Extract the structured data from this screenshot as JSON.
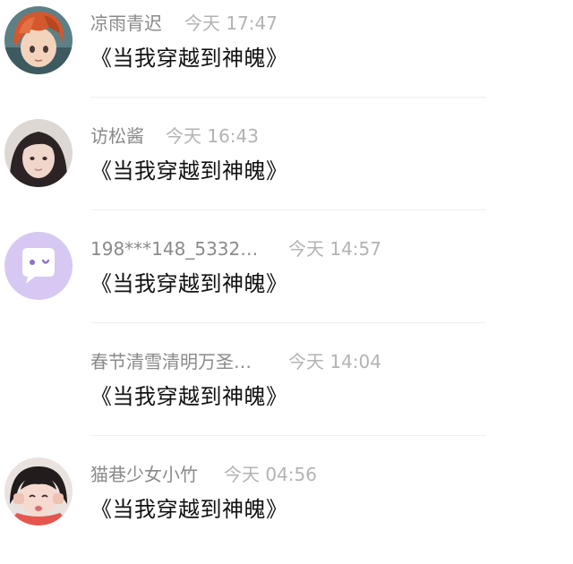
{
  "messages": [
    {
      "avatar": "avatar-anime-boy",
      "username": "凉雨青迟",
      "time": "今天 17:47",
      "text": "《当我穿越到神魄》"
    },
    {
      "avatar": "avatar-girl-photo",
      "username": "访松酱",
      "time": "今天 16:43",
      "text": "《当我穿越到神魄》"
    },
    {
      "avatar": "avatar-default-chat",
      "username": "198***148_5332…",
      "time": "今天 14:57",
      "text": "《当我穿越到神魄》"
    },
    {
      "avatar": "",
      "username": "春节清雪清明万圣…",
      "time": "今天 14:04",
      "text": "《当我穿越到神魄》"
    },
    {
      "avatar": "avatar-child-photo",
      "username": "猫巷少女小竹",
      "time": "今天 04:56",
      "text": "《当我穿越到神魄》"
    }
  ],
  "colors": {
    "username": "#8a8a8a",
    "time": "#b3b3b3",
    "text": "#111111",
    "divider": "#efefef",
    "default_avatar_bg": "#d7c8f3"
  }
}
